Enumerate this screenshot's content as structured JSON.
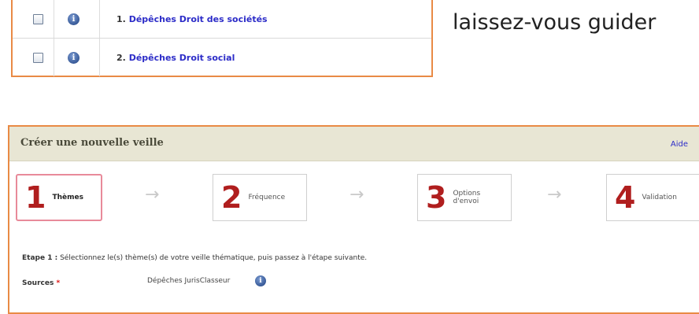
{
  "list": {
    "rows": [
      {
        "number": "1.",
        "label": "Dépêches Droit des sociétés"
      },
      {
        "number": "2.",
        "label": "Dépêches Droit social"
      }
    ]
  },
  "tagline": "laissez-vous guider",
  "panel": {
    "title": "Créer une nouvelle veille",
    "help": "Aide",
    "steps": [
      {
        "number": "1",
        "label": "Thèmes"
      },
      {
        "number": "2",
        "label": "Fréquence"
      },
      {
        "number": "3",
        "label_line1": "Options",
        "label_line2": "d'envoi"
      },
      {
        "number": "4",
        "label": "Validation"
      }
    ],
    "intro_label": "Etape 1 :",
    "intro_text": "Sélectionnez le(s) thème(s) de votre veille thématique, puis passez à l'étape suivante.",
    "sources_label": "Sources",
    "required_mark": "*",
    "sources_value": "Dépêches JurisClasseur"
  },
  "icons": {
    "info": "info-icon",
    "arrow": "arrow-right-icon"
  },
  "colors": {
    "border_accent": "#e98a45",
    "step_number": "#b01e1e",
    "link": "#2c2cc8",
    "header_bg": "#e8e6d4"
  }
}
